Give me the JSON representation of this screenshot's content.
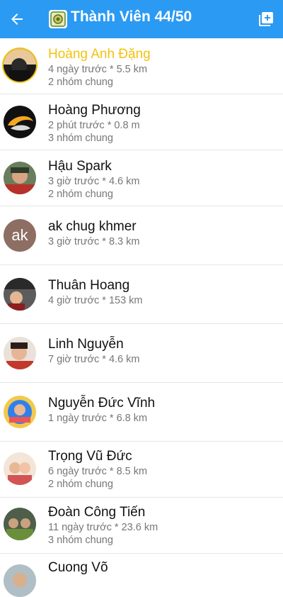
{
  "header": {
    "title": "Thành Viên 44/50",
    "back_icon": "arrow-left-icon",
    "add_icon": "add-square-icon",
    "background": "#2b9af3"
  },
  "members": [
    {
      "name": "Hoàng Anh Đặng",
      "meta": "4 ngày trước * 5.5 km",
      "groups": "2 nhóm chung",
      "highlight": true
    },
    {
      "name": "Hoàng Phương",
      "meta": "2 phút trước * 0.8 m",
      "groups": "3 nhóm chung"
    },
    {
      "name": "Hậu Spark",
      "meta": "3 giờ trước * 4.6 km",
      "groups": "2 nhóm chung"
    },
    {
      "name": "ak chug khmer",
      "meta": "3 giờ trước * 8.3 km",
      "avatar_text": "ak"
    },
    {
      "name": "Thuân Hoang",
      "meta": "4 giờ trước * 153 km"
    },
    {
      "name": "Linh Nguyễn",
      "meta": "7 giờ trước * 4.6 km"
    },
    {
      "name": "Nguyễn Đức Vĩnh",
      "meta": "1 ngày trước * 6.8 km"
    },
    {
      "name": "Trọng Vũ Đức",
      "meta": "6 ngày trước * 8.5 km",
      "groups": "2 nhóm chung"
    },
    {
      "name": "Đoàn Công Tiến",
      "meta": "11 ngày trước * 23.6 km",
      "groups": "3 nhóm chung"
    },
    {
      "name": "Cuong Võ"
    }
  ]
}
